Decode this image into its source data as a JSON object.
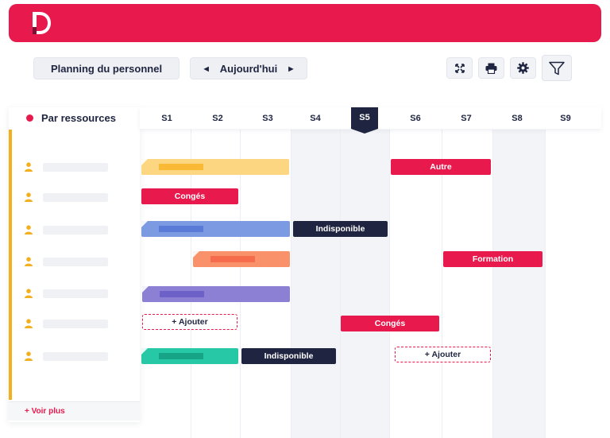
{
  "app": {
    "logo_icon": "logo-d-icon",
    "brand_color": "#e8194c"
  },
  "toolbar": {
    "planning_label": "Planning du personnel",
    "today_label": "Aujourd'hui",
    "prev_icon": "triangle-left-icon",
    "next_icon": "triangle-right-icon",
    "expand_icon": "expand-icon",
    "print_icon": "printer-icon",
    "settings_icon": "gear-icon",
    "filter_icon": "filter-icon"
  },
  "sidebar": {
    "title": "Par ressources",
    "voir_plus": "+ Voir plus",
    "row_count": 7
  },
  "weeks": [
    "S1",
    "S2",
    "S3",
    "S4",
    "S5",
    "S6",
    "S7",
    "S8",
    "S9"
  ],
  "current_week": "S5",
  "events": {
    "autre": "Autre",
    "conges_1": "Congés",
    "indispo_1": "Indisponible",
    "formation": "Formation",
    "ajouter_1": "+ Ajouter",
    "conges_2": "Congés",
    "indispo_2": "Indisponible",
    "ajouter_2": "+ Ajouter"
  },
  "colors": {
    "red": "#e8194c",
    "navy": "#1f2540",
    "yellow": "#fcd680",
    "blue": "#7b9ae2",
    "orange": "#f9926a",
    "purple": "#8c80d4",
    "teal": "#26c8a6"
  }
}
